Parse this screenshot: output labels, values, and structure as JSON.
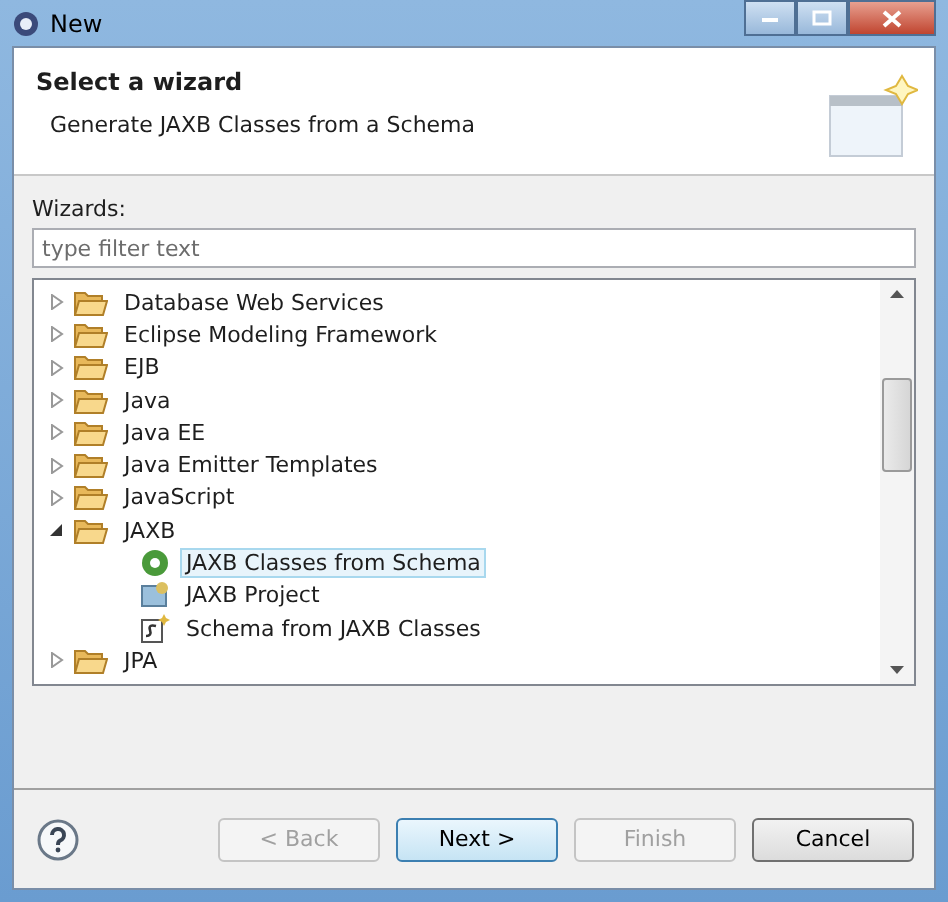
{
  "window": {
    "title": "New"
  },
  "header": {
    "title": "Select a wizard",
    "description": "Generate JAXB Classes from a Schema"
  },
  "filter": {
    "label": "Wizards:",
    "placeholder": "type filter text"
  },
  "tree": [
    {
      "label": "Database Web Services",
      "expanded": false
    },
    {
      "label": "Eclipse Modeling Framework",
      "expanded": false
    },
    {
      "label": "EJB",
      "expanded": false
    },
    {
      "label": "Java",
      "expanded": false
    },
    {
      "label": "Java EE",
      "expanded": false
    },
    {
      "label": "Java Emitter Templates",
      "expanded": false
    },
    {
      "label": "JavaScript",
      "expanded": false
    },
    {
      "label": "JAXB",
      "expanded": true,
      "children": [
        {
          "label": "JAXB Classes from Schema",
          "kind": "generator",
          "selected": true
        },
        {
          "label": "JAXB Project",
          "kind": "project",
          "selected": false
        },
        {
          "label": "Schema from JAXB Classes",
          "kind": "schema",
          "selected": false
        }
      ]
    },
    {
      "label": "JPA",
      "expanded": false
    }
  ],
  "buttons": [
    {
      "label": "< Back",
      "disabled": true,
      "default": false
    },
    {
      "label": "Next >",
      "disabled": false,
      "default": true
    },
    {
      "label": "Finish",
      "disabled": true,
      "default": false
    },
    {
      "label": "Cancel",
      "disabled": false,
      "default": false
    }
  ]
}
